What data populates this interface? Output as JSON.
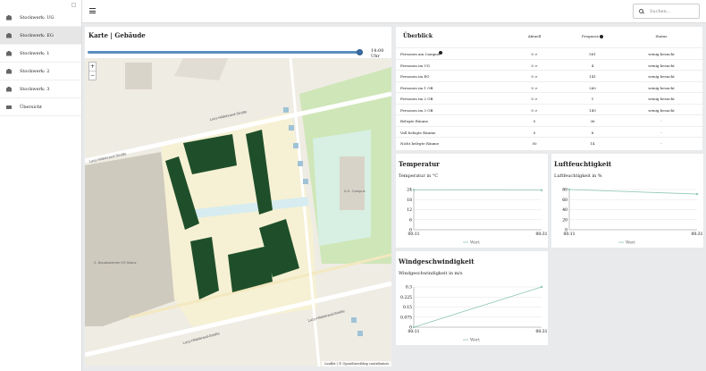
{
  "sidebar": {
    "items": [
      {
        "label": "Stockwerk: UG",
        "icon": "building-icon"
      },
      {
        "label": "Stockwerk: EG",
        "icon": "building-icon"
      },
      {
        "label": "Stockwerk: 1",
        "icon": "building-icon"
      },
      {
        "label": "Stockwerk: 2",
        "icon": "building-icon"
      },
      {
        "label": "Stockwerk: 3",
        "icon": "building-icon"
      },
      {
        "label": "Übersicht",
        "icon": "list-icon"
      }
    ]
  },
  "topbar": {
    "menu_icon": "menu-icon",
    "search_placeholder": "Suchen..."
  },
  "map": {
    "title": "Karte | Gebäude",
    "time": "14:00 Uhr",
    "zoom_in": "+",
    "zoom_out": "−",
    "labels": {
      "street1": "Lucy-Hildebrand-Straße",
      "street2": "Lucy-Hildebrand-Straße",
      "street3": "Lucy-Hildebrand-Straße",
      "street4": "Lucy-Hildebrand-Straße",
      "school": "Z. Bauakademie HS Mainz",
      "park": "A.S. Campus"
    },
    "attribution": "Leaflet | © OpenStreetMap contributors"
  },
  "overview": {
    "title": "Überblick",
    "headers": [
      "Aktuell",
      "Prognose",
      "Status"
    ],
    "rows": [
      {
        "label": "Personen am Campus",
        "info": true,
        "aktuell": "0 >",
        "prognose": "561",
        "status": "wenig besucht"
      },
      {
        "label": "Personen im UG",
        "aktuell": "0 >",
        "prognose": "4",
        "status": "wenig besucht"
      },
      {
        "label": "Personen im EG",
        "aktuell": "0 >",
        "prognose": "141",
        "status": "wenig besucht"
      },
      {
        "label": "Personen im 1 OB",
        "aktuell": "0 >",
        "prognose": "260",
        "status": "wenig besucht"
      },
      {
        "label": "Personen im 2 OB",
        "aktuell": "0 >",
        "prognose": "1",
        "status": "wenig besucht"
      },
      {
        "label": "Personen im 3 OB",
        "aktuell": "0 >",
        "prognose": "149",
        "status": "wenig besucht"
      },
      {
        "label": "Belegte Räume",
        "aktuell": "0",
        "prognose": "36",
        "status": "-"
      },
      {
        "label": "Voll belegte Räume",
        "aktuell": "0",
        "prognose": "8",
        "status": "-"
      },
      {
        "label": "Nicht belegte Räume",
        "aktuell": "50",
        "prognose": "14",
        "status": "-"
      }
    ]
  },
  "temperature": {
    "title": "Temperatur",
    "subtitle": "Temperatur in °C",
    "legend": "Wert",
    "ticks": [
      "24",
      "18",
      "12",
      "6",
      "0"
    ],
    "xticks": [
      "00:11",
      "00:31"
    ]
  },
  "humidity": {
    "title": "Luftfeuchtigkeit",
    "subtitle": "Luftfeuchtigkeit in %",
    "legend": "Wert",
    "ticks": [
      "80",
      "60",
      "40",
      "20",
      "0"
    ],
    "xticks": [
      "00:11",
      "00:31"
    ]
  },
  "wind": {
    "title": "Windgeschwindigkeit",
    "subtitle": "Windgeschwindigkeit in m/s",
    "legend": "Wert",
    "ticks": [
      "0.3",
      "0.225",
      "0.15",
      "0.075",
      "0"
    ],
    "xticks": [
      "00:11",
      "00:31"
    ]
  },
  "chart_data": [
    {
      "type": "line",
      "title": "Temperatur",
      "ylabel": "Temperatur in °C",
      "x": [
        "00:11",
        "00:31"
      ],
      "series": [
        {
          "name": "Wert",
          "values": [
            23.8,
            23.6
          ]
        }
      ],
      "ylim": [
        0,
        24
      ]
    },
    {
      "type": "line",
      "title": "Luftfeuchtigkeit",
      "ylabel": "Luftfeuchtigkeit in %",
      "x": [
        "00:11",
        "00:31"
      ],
      "series": [
        {
          "name": "Wert",
          "values": [
            80,
            71
          ]
        }
      ],
      "ylim": [
        0,
        80
      ]
    },
    {
      "type": "line",
      "title": "Windgeschwindigkeit",
      "ylabel": "Windgeschwindigkeit in m/s",
      "x": [
        "00:11",
        "00:31"
      ],
      "series": [
        {
          "name": "Wert",
          "values": [
            0,
            0.3
          ]
        }
      ],
      "ylim": [
        0,
        0.3
      ]
    }
  ],
  "colors": {
    "series": "#8fc7b0",
    "building": "#1f4f2a",
    "road": "#ffffff",
    "land": "#f4efd8"
  }
}
